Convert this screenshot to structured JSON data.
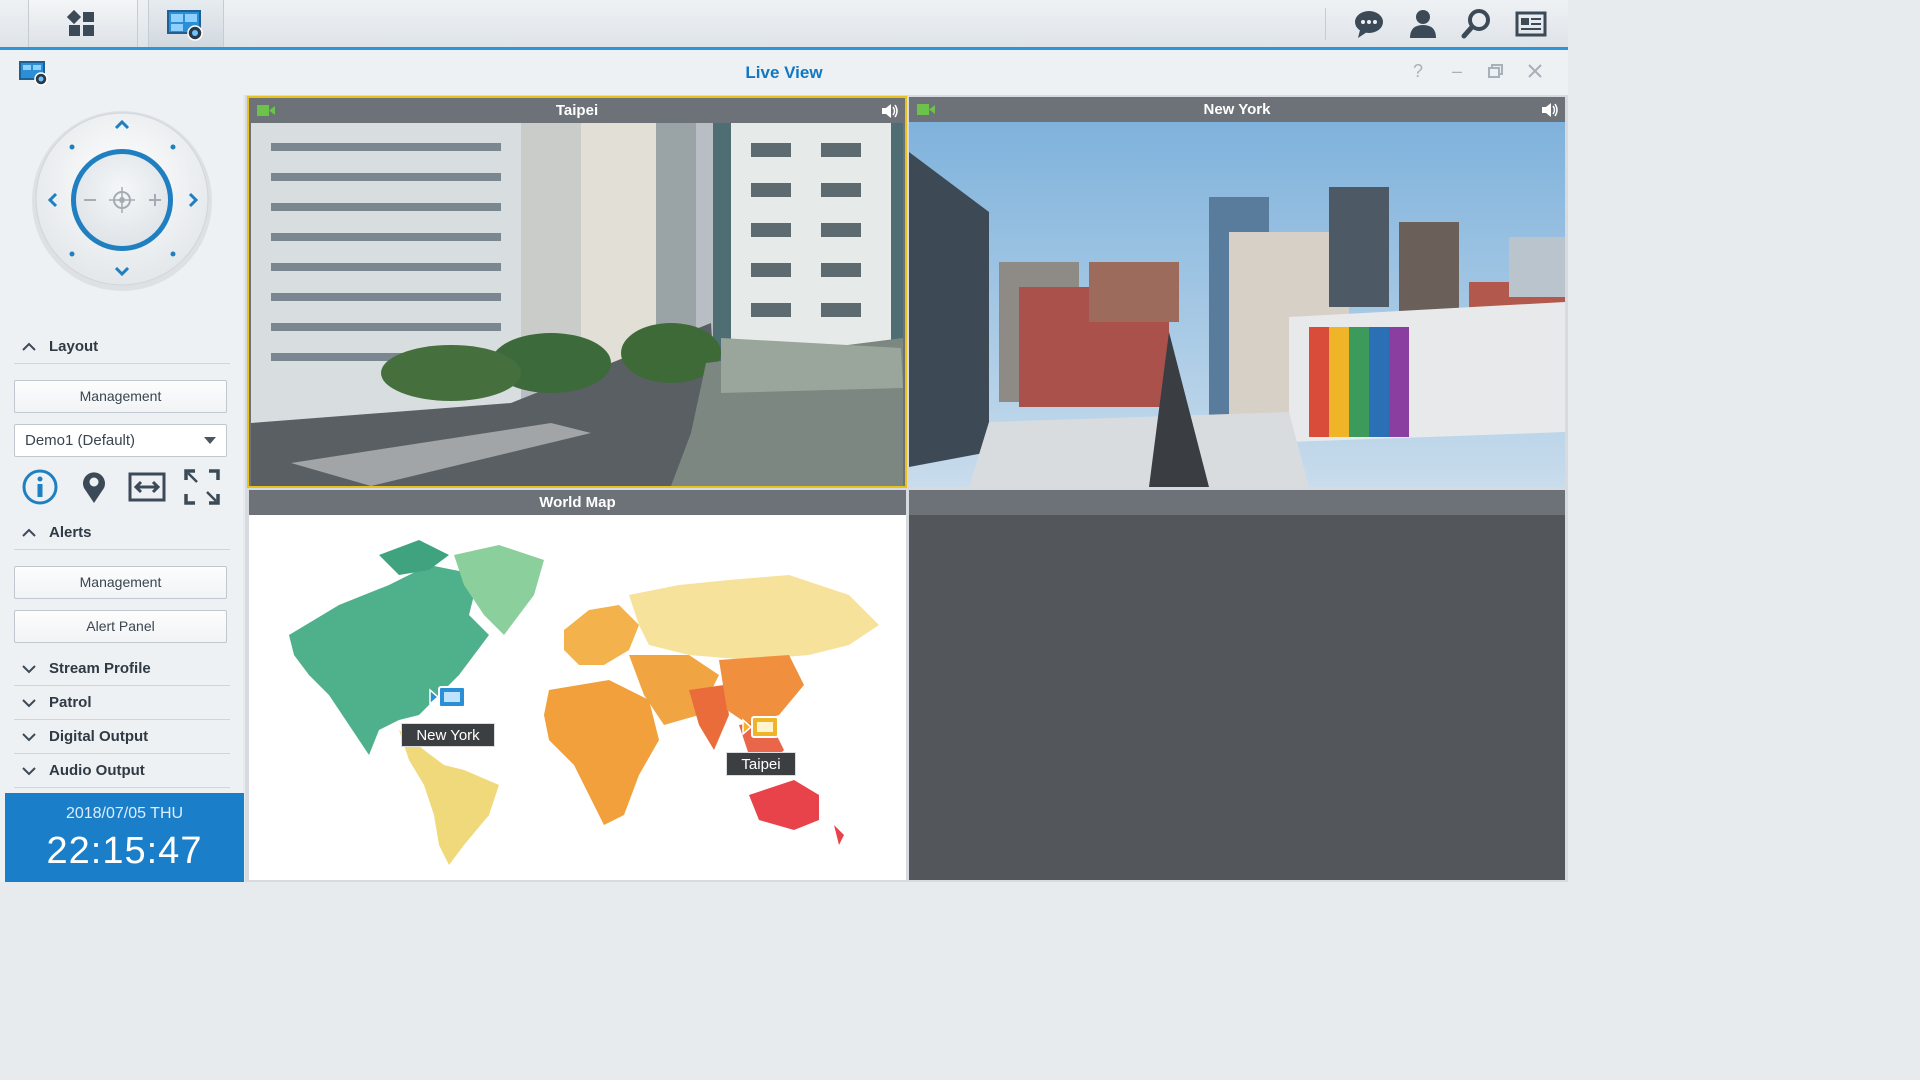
{
  "window": {
    "title": "Live View"
  },
  "taskbar": {
    "icons": [
      "main-menu-icon",
      "surveillance-app-icon",
      "notifications-icon",
      "user-icon",
      "search-icon",
      "widgets-icon"
    ]
  },
  "sidebar": {
    "layout": {
      "label": "Layout",
      "management": "Management",
      "selected_layout": "Demo1 (Default)"
    },
    "alerts": {
      "label": "Alerts",
      "management": "Management",
      "alert_panel": "Alert Panel"
    },
    "sections": [
      {
        "label": "Stream Profile"
      },
      {
        "label": "Patrol"
      },
      {
        "label": "Digital Output"
      },
      {
        "label": "Audio Output"
      }
    ],
    "clock": {
      "date": "2018/07/05  THU",
      "time": "22:15:47"
    }
  },
  "panes": {
    "taipei": {
      "title": "Taipei"
    },
    "newyork": {
      "title": "New York"
    },
    "worldmap": {
      "title": "World Map",
      "markers": [
        {
          "label": "New York"
        },
        {
          "label": "Taipei"
        }
      ]
    }
  },
  "colors": {
    "accent": "#0f78c2",
    "active_border": "#e8c21a",
    "clock_bg": "#1a7fc8",
    "empty_pane": "#53575b"
  }
}
